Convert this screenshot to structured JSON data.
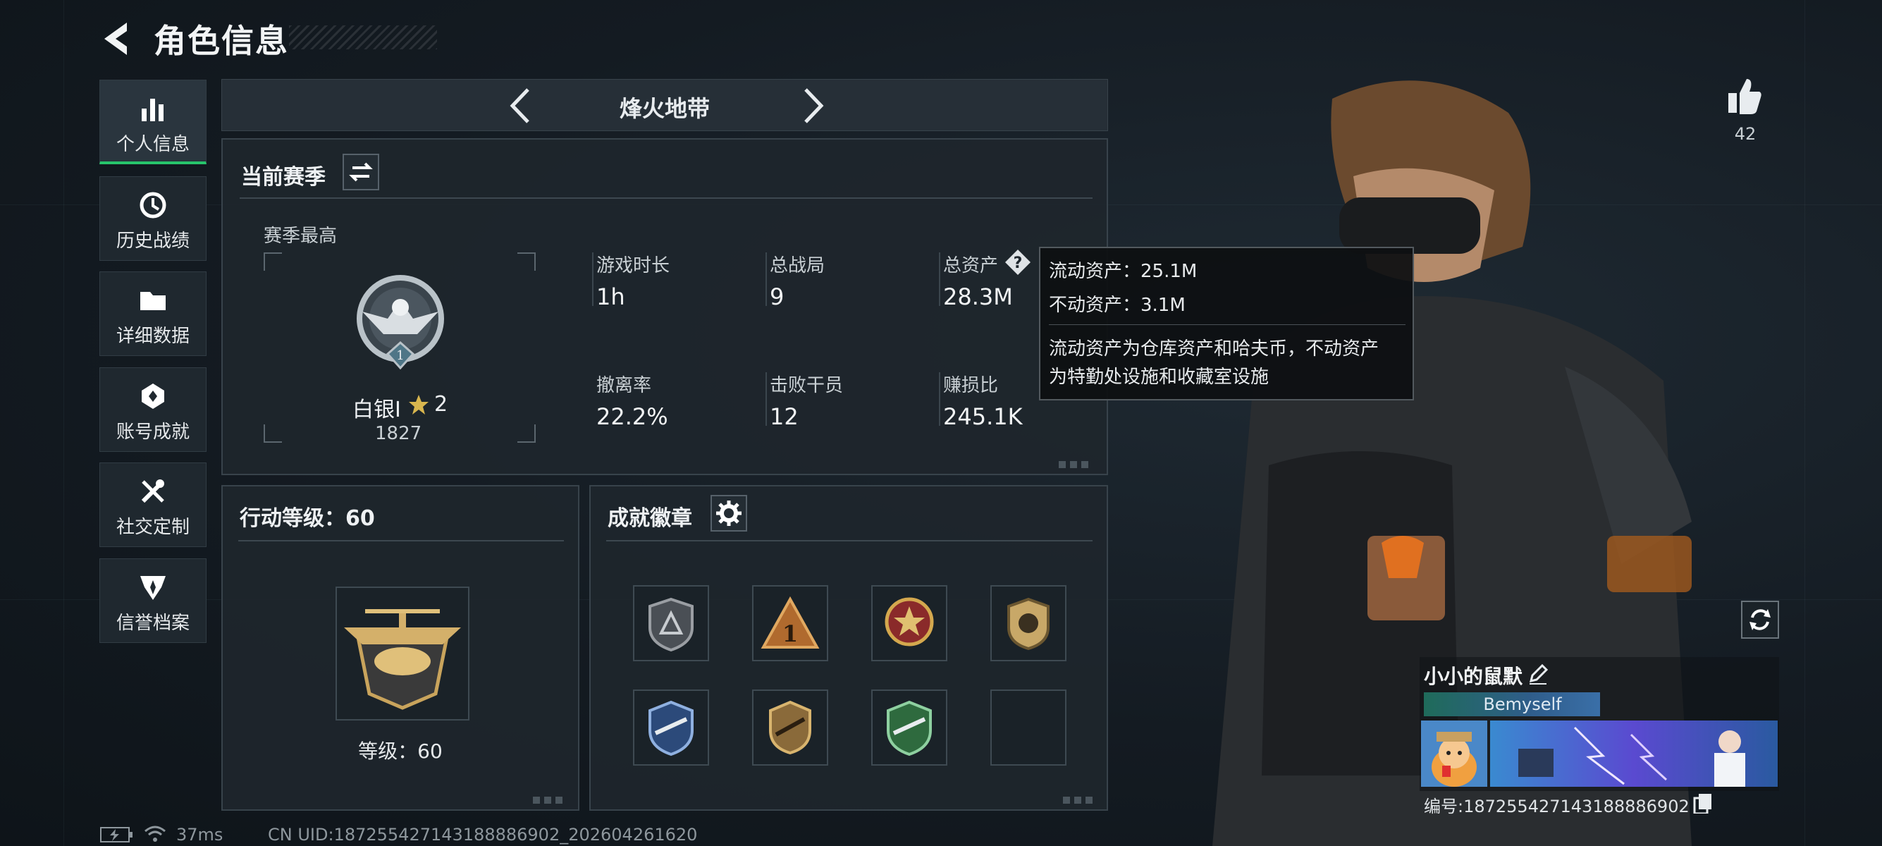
{
  "header": {
    "title": "角色信息"
  },
  "sidebar": {
    "items": [
      {
        "label": "个人信息",
        "icon": "bar-chart-icon",
        "active": true
      },
      {
        "label": "历史战绩",
        "icon": "history-icon"
      },
      {
        "label": "详细数据",
        "icon": "folder-icon"
      },
      {
        "label": "账号成就",
        "icon": "achievement-icon"
      },
      {
        "label": "社交定制",
        "icon": "tools-icon"
      },
      {
        "label": "信誉档案",
        "icon": "credibility-icon"
      }
    ]
  },
  "mode": {
    "name": "烽火地带"
  },
  "season": {
    "title": "当前赛季",
    "best_label": "赛季最高",
    "rank_name": "白银I",
    "rank_stars": "2",
    "rank_score": "1827",
    "rank_emblem_number": "1",
    "stats": [
      {
        "label": "游戏时长",
        "value": "1h"
      },
      {
        "label": "总战局",
        "value": "9"
      },
      {
        "label": "总资产",
        "value": "28.3M"
      },
      {
        "label": "撤离率",
        "value": "22.2%"
      },
      {
        "label": "击败干员",
        "value": "12"
      },
      {
        "label": "赚损比",
        "value": "245.1K"
      }
    ]
  },
  "tooltip": {
    "liquid": "流动资产：25.1M",
    "fixed": "不动资产：3.1M",
    "desc1": "流动资产为仓库资产和哈夫币，不动资产",
    "desc2": "为特勤处设施和收藏室设施"
  },
  "action_level": {
    "title": "行动等级：60",
    "level_text": "等级：60"
  },
  "badges": {
    "title": "成就徽章"
  },
  "profile": {
    "likes": "42",
    "name": "小小的鼠默",
    "tag": "Bemyself",
    "id_text": "编号:187255427143188886902"
  },
  "footer": {
    "ping": "37ms",
    "uid": "CN UID:187255427143188886902_202604261620"
  },
  "colors": {
    "accent": "#27c46b",
    "panel": "#1e262d",
    "border": "#38434b"
  }
}
